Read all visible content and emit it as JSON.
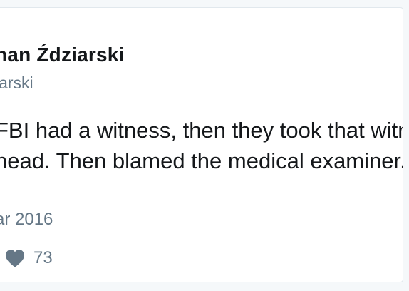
{
  "tweet": {
    "author_name": "han Ździarski",
    "author_handle": "iarski",
    "text_lines": [
      "FBI had a witness, then they took that witne",
      "head. Then blamed the medical examiner. T",
      "."
    ],
    "date": "ar 2016",
    "like_count": "73",
    "colors": {
      "accent": "#1da1f2",
      "muted": "#657786",
      "text": "#14171a"
    },
    "icons": {
      "like": "heart-icon"
    }
  }
}
